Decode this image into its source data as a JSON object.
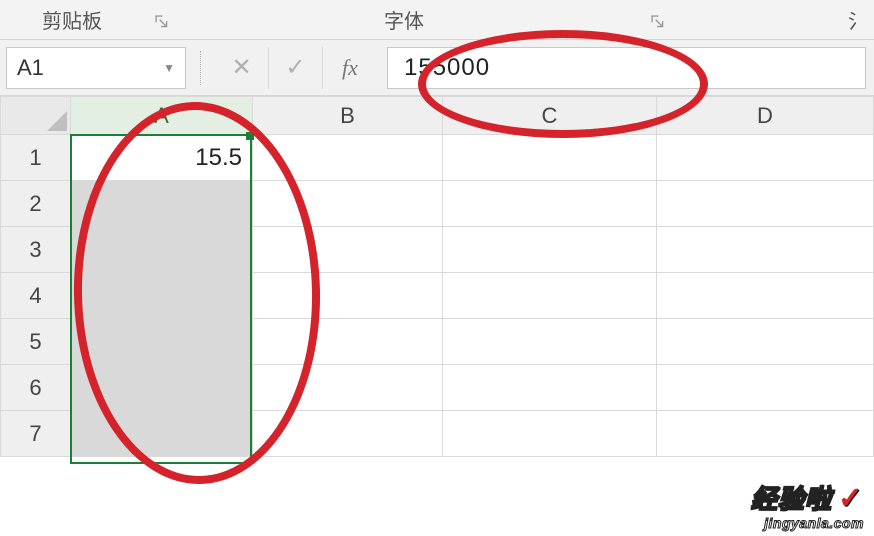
{
  "ribbon": {
    "clipboard_label": "剪贴板",
    "font_label": "字体",
    "right_truncated": "氵"
  },
  "name_box": {
    "value": "A1"
  },
  "formula_bar": {
    "cancel": "✕",
    "accept": "✓",
    "fx": "fx",
    "value": "155000"
  },
  "columns": [
    "A",
    "B",
    "C",
    "D"
  ],
  "rows": [
    "1",
    "2",
    "3",
    "4",
    "5",
    "6",
    "7"
  ],
  "cells": {
    "A1": "15.5"
  },
  "selection": {
    "column": "A",
    "rows_from": 1,
    "active_cell": "A1"
  },
  "watermark": {
    "title": "经验啦",
    "check": "✓",
    "url": "jingyanla.com"
  }
}
